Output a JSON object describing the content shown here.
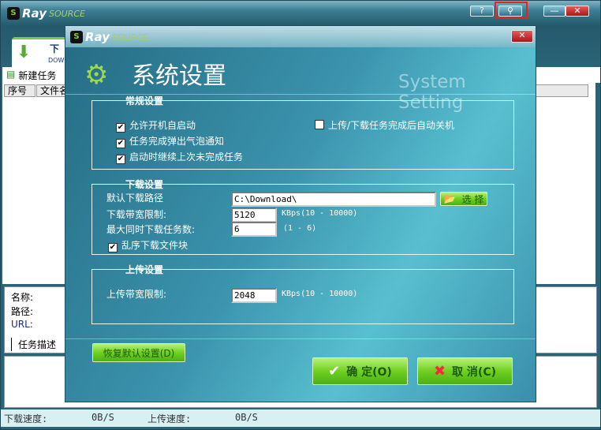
{
  "main": {
    "logo": "Ray",
    "logo_suffix": "SOURCE",
    "help": "?",
    "tools": "⚲",
    "minimize": "—",
    "close": "✕",
    "tab_title": "下",
    "tab_sub": "DOWN",
    "new_task": "新建任务",
    "columns": [
      "序号",
      "文件名"
    ],
    "info": {
      "name": "名称:",
      "path": "路径:",
      "url": "URL:",
      "tab": "任务描述"
    },
    "status": {
      "down_label": "下载速度:",
      "down_value": "0B/S",
      "up_label": "上传速度:",
      "up_value": "0B/S"
    }
  },
  "dialog": {
    "logo": "Ray",
    "logo_suffix": "SOURCE",
    "close": "✕",
    "title": "系统设置",
    "title_en": "System Setting",
    "general": {
      "title": "常规设置",
      "autostart": "允许开机自启动",
      "bubble": "任务完成弹出气泡通知",
      "resume": "启动时继续上次未完成任务",
      "shutdown": "上传/下载任务完成后自动关机"
    },
    "download": {
      "title": "下载设置",
      "path_label": "默认下载路径",
      "path_value": "C:\\Download\\",
      "browse": "选 择",
      "bw_label": "下载带宽限制:",
      "bw_value": "5120",
      "bw_range": "KBps(10 - 10000)",
      "max_label": "最大同时下载任务数:",
      "max_value": "6",
      "max_range": "(1 - 6)",
      "random": "乱序下载文件块"
    },
    "upload": {
      "title": "上传设置",
      "bw_label": "上传带宽限制:",
      "bw_value": "2048",
      "bw_range": "KBps(10 - 10000)"
    },
    "restore": "恢复默认设置(D)",
    "ok": "确 定(O)",
    "cancel": "取 消(C)"
  },
  "colors": {
    "highlight": "#e8221c",
    "accent": "#6fd020"
  }
}
